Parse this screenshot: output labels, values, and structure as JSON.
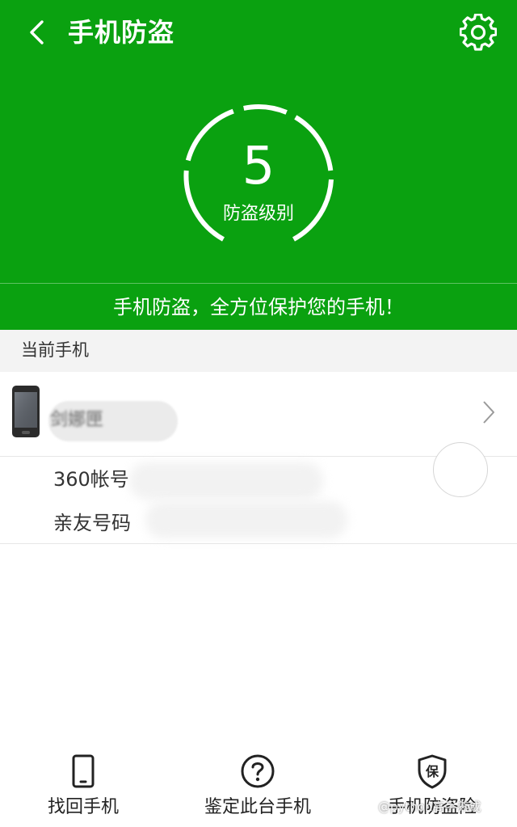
{
  "topbar": {
    "title": "手机防盗",
    "back_icon": "chevron-left-icon",
    "settings_icon": "gear-icon"
  },
  "protection": {
    "level_value": "5",
    "level_label": "防盗级别"
  },
  "slogan": "手机防盗，全方位保护您的手机！",
  "current_phone": {
    "section_title": "当前手机",
    "device_name": "剑娜匣",
    "items": [
      {
        "label": "360帐号"
      },
      {
        "label": "亲友号码"
      }
    ]
  },
  "bottom_nav": {
    "items": [
      {
        "label": "找回手机",
        "icon": "phone-icon"
      },
      {
        "label": "鉴定此台手机",
        "icon": "question-circle-icon"
      },
      {
        "label": "手机防盗险",
        "icon": "shield-icon"
      }
    ]
  },
  "watermark": "@python高手养成",
  "colors": {
    "brand_green": "#0aa110",
    "section_bg": "#f3f3f3"
  }
}
